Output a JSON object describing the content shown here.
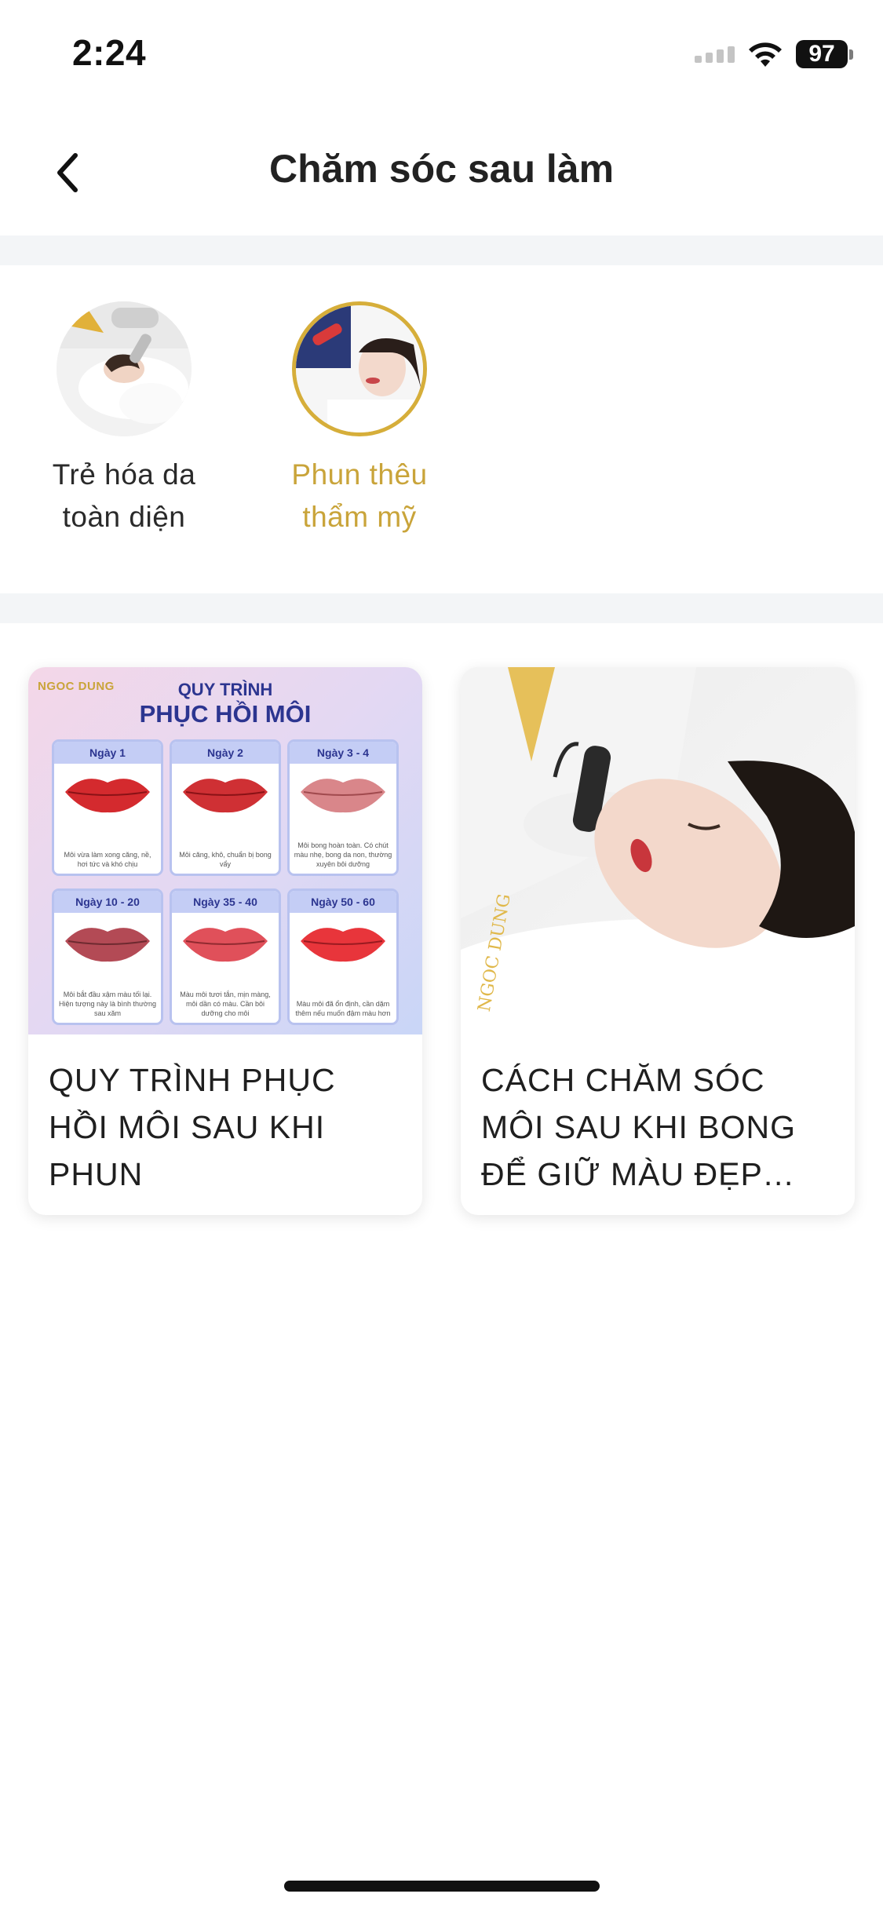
{
  "status_bar": {
    "time": "2:24",
    "battery": "97",
    "icons": [
      "signal-icon",
      "wifi-icon",
      "battery-icon"
    ]
  },
  "header": {
    "title": "Chăm sóc sau làm",
    "back_icon": "chevron-left-icon"
  },
  "categories": [
    {
      "label": "Trẻ hóa da toàn diện",
      "active": false
    },
    {
      "label": "Phun thêu thẩm mỹ",
      "active": true
    }
  ],
  "cards": [
    {
      "title": "QUY TRÌNH PHỤC HỒI MÔI SAU KHI PHUN",
      "image": {
        "logo": "NGOC DUNG",
        "heading_line1": "QUY TRÌNH",
        "heading_line2": "PHỤC HỒI MÔI",
        "stages": [
          {
            "day": "Ngày 1",
            "note": "Môi vừa làm xong căng, nề, hơi tức và khó chịu"
          },
          {
            "day": "Ngày 2",
            "note": "Môi căng, khô, chuẩn bị bong vẩy"
          },
          {
            "day": "Ngày 3 - 4",
            "note": "Môi bong hoàn toàn. Có chút màu nhẹ, bong da non, thường xuyên bôi dưỡng"
          },
          {
            "day": "Ngày 10 - 20",
            "note": "Môi bắt đầu xậm màu tối lại. Hiện tượng này là bình thường sau xăm"
          },
          {
            "day": "Ngày 35 - 40",
            "note": "Màu môi tươi tắn, mịn màng, môi dần có màu. Cần bôi dưỡng cho môi"
          },
          {
            "day": "Ngày 50 - 60",
            "note": "Màu môi đã ổn định, cần dặm thêm nếu muốn đậm màu hơn"
          }
        ]
      }
    },
    {
      "title": "CÁCH CHĂM SÓC MÔI SAU KHI BONG ĐỂ GIỮ MÀU ĐẸP NGỌC DUNG"
    }
  ],
  "colors": {
    "accent_gold": "#c9a43a",
    "divider": "#f3f5f7",
    "text": "#1f1f1f"
  }
}
